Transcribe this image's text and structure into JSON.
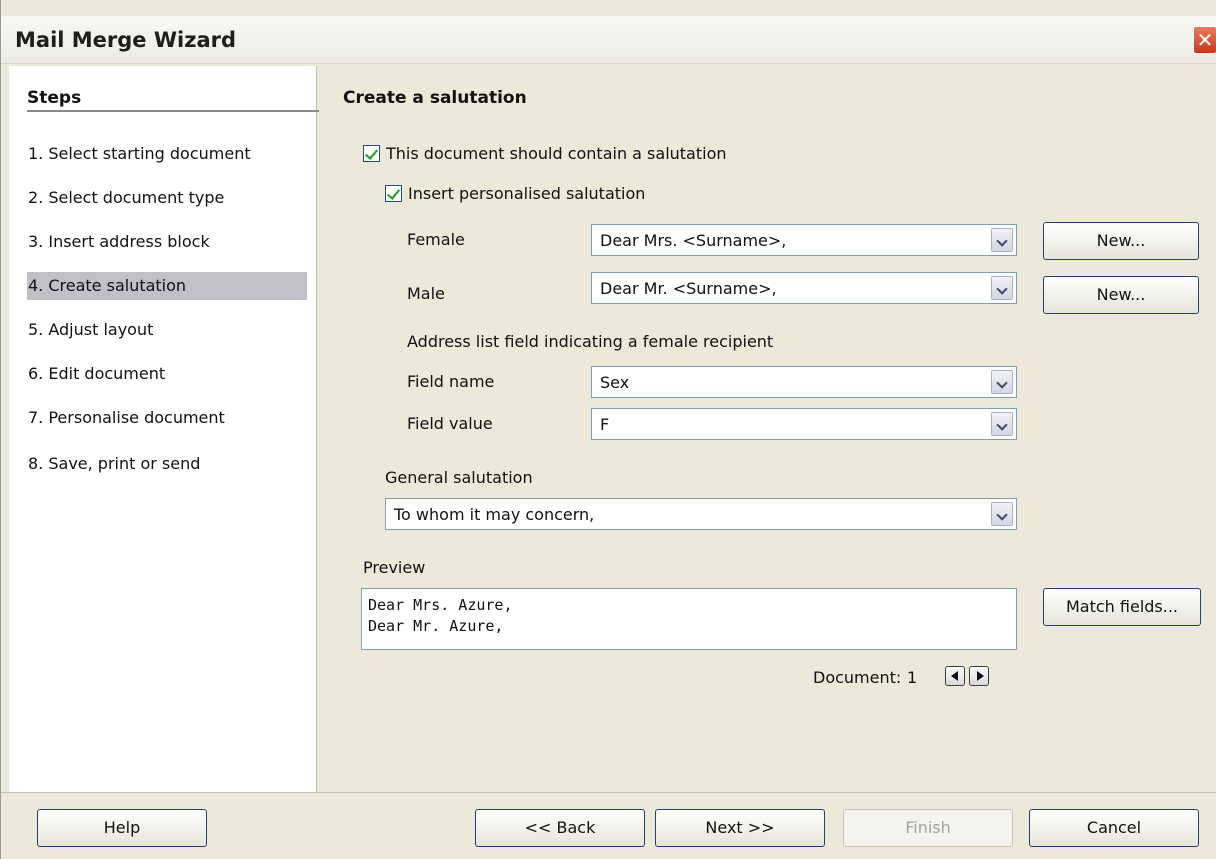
{
  "window": {
    "title": "Mail Merge Wizard",
    "close_glyph": "✕"
  },
  "steps": {
    "heading": "Steps",
    "items": [
      "1. Select starting document",
      "2. Select document type",
      "3. Insert address block",
      "4. Create salutation",
      "5. Adjust layout",
      "6. Edit document",
      "7. Personalise document",
      "8. Save, print or send"
    ],
    "active_index": 3
  },
  "main": {
    "heading": "Create a salutation",
    "contain_salutation_label": "This document should contain a salutation",
    "personalised_label": "Insert personalised salutation",
    "female_label": "Female",
    "female_value": "Dear Mrs. <Surname>,",
    "male_label": "Male",
    "male_value": "Dear Mr. <Surname>,",
    "new_label": "New...",
    "address_field_label": "Address list field indicating a female recipient",
    "field_name_label": "Field name",
    "field_name_value": "Sex",
    "field_value_label": "Field value",
    "field_value_value": "F",
    "general_label": "General salutation",
    "general_value": "To whom it may concern,",
    "preview_label": "Preview",
    "preview_lines": [
      "Dear Mrs. Azure,",
      "Dear Mr. Azure,"
    ],
    "match_fields_label": "Match fields...",
    "document_label": "Document:",
    "document_number": "1"
  },
  "footer": {
    "help": "Help",
    "back": "<< Back",
    "next": "Next >>",
    "finish": "Finish",
    "cancel": "Cancel"
  }
}
